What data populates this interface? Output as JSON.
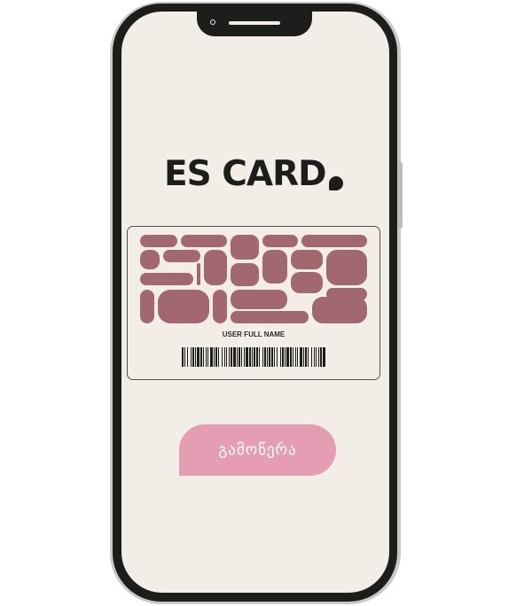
{
  "brand": {
    "name": "ES CARD"
  },
  "card": {
    "holder_label": "USER FULL NAME",
    "pattern_color": "#a2686f",
    "barcode_icon": "barcode-icon"
  },
  "actions": {
    "subscribe_label": "გამოწერა"
  },
  "colors": {
    "screen_background": "#f3ede7",
    "button": "#e59db4",
    "frame": "#1d1d1b"
  }
}
